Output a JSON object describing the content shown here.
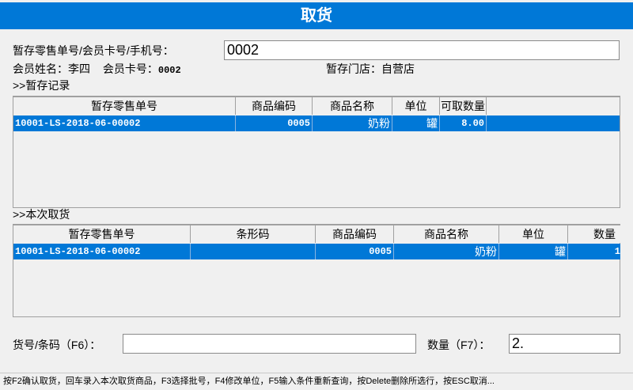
{
  "title": "取货",
  "search": {
    "label": "暂存零售单号/会员卡号/手机号：",
    "value": "0002"
  },
  "member": {
    "name_label": "会员姓名：",
    "name": "李四",
    "card_label": "会员卡号：",
    "card": "0002",
    "store_label": "暂存门店：",
    "store": "自营店"
  },
  "held": {
    "section": ">>暂存记录",
    "columns": [
      "暂存零售单号",
      "商品编码",
      "商品名称",
      "单位",
      "可取数量",
      ""
    ],
    "rows": [
      {
        "order": "10001-LS-2018-06-00002",
        "code": "0005",
        "name": "奶粉",
        "unit": "罐",
        "qty": "8.00"
      }
    ]
  },
  "current": {
    "section": ">>本次取货",
    "columns": [
      "暂存零售单号",
      "条形码",
      "商品编码",
      "商品名称",
      "单位",
      "数量"
    ],
    "rows": [
      {
        "order": "10001-LS-2018-06-00002",
        "barcode": "",
        "code": "0005",
        "name": "奶粉",
        "unit": "罐",
        "qty": "1"
      }
    ]
  },
  "barcode": {
    "label": "货号/条码（F6）：",
    "value": ""
  },
  "quantity": {
    "label": "数量（F7）：",
    "value": "2."
  },
  "status": "按F2确认取货，回车录入本次取货商品，F3选择批号，F4修改单位，F5输入条件重新查询，按Delete删除所选行，按ESC取消..."
}
